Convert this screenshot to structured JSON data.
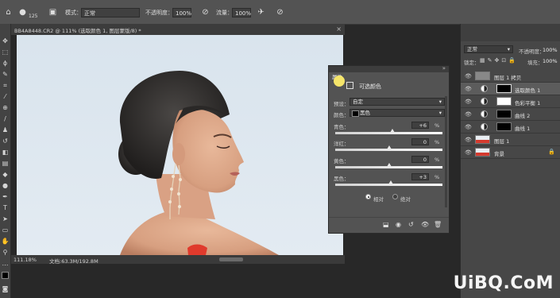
{
  "options_bar": {
    "brush_size": "125",
    "mode_label": "模式：",
    "mode_value": "正常",
    "opacity_label": "不透明度：",
    "opacity_value": "100%",
    "flow_label": "流量：",
    "flow_value": "100%"
  },
  "document": {
    "tab_title": "BB4A8448.CR2 @ 111% (选取颜色 1, 图层蒙版/8) *",
    "zoom": "111.18%",
    "doc_info": "文档:63.3M/192.8M"
  },
  "properties_dialog": {
    "title": "属性",
    "section": "可选颜色",
    "preset_label": "预设：",
    "preset_value": "自定",
    "color_label": "颜色：",
    "color_value": "黑色",
    "sliders": [
      {
        "label": "青色：",
        "value": "+6",
        "unit": "%",
        "position": 0.53
      },
      {
        "label": "洋红：",
        "value": "0",
        "unit": "%",
        "position": 0.5
      },
      {
        "label": "黄色：",
        "value": "0",
        "unit": "%",
        "position": 0.5
      },
      {
        "label": "黑色：",
        "value": "+3",
        "unit": "%",
        "position": 0.515
      }
    ],
    "radio_relative": "相对",
    "radio_absolute": "绝对"
  },
  "layers_panel": {
    "blend_mode": "正常",
    "opacity_label": "不透明度：",
    "opacity_value": "100%",
    "lock_label": "锁定：",
    "fill_label": "填充：",
    "fill_value": "100%",
    "layers": [
      {
        "name": "图层 1 拷贝",
        "type": "pixel",
        "selected": false
      },
      {
        "name": "选取颜色 1",
        "type": "adjustment",
        "selected": true
      },
      {
        "name": "色彩平衡 1",
        "type": "adjustment",
        "selected": false
      },
      {
        "name": "曲线 2",
        "type": "adjustment",
        "selected": false
      },
      {
        "name": "曲线 1",
        "type": "adjustment",
        "selected": false
      },
      {
        "name": "图层 1",
        "type": "pixel",
        "selected": false
      },
      {
        "name": "背景",
        "type": "pixel",
        "selected": false
      }
    ]
  },
  "watermark": "UiBQ.CoM"
}
